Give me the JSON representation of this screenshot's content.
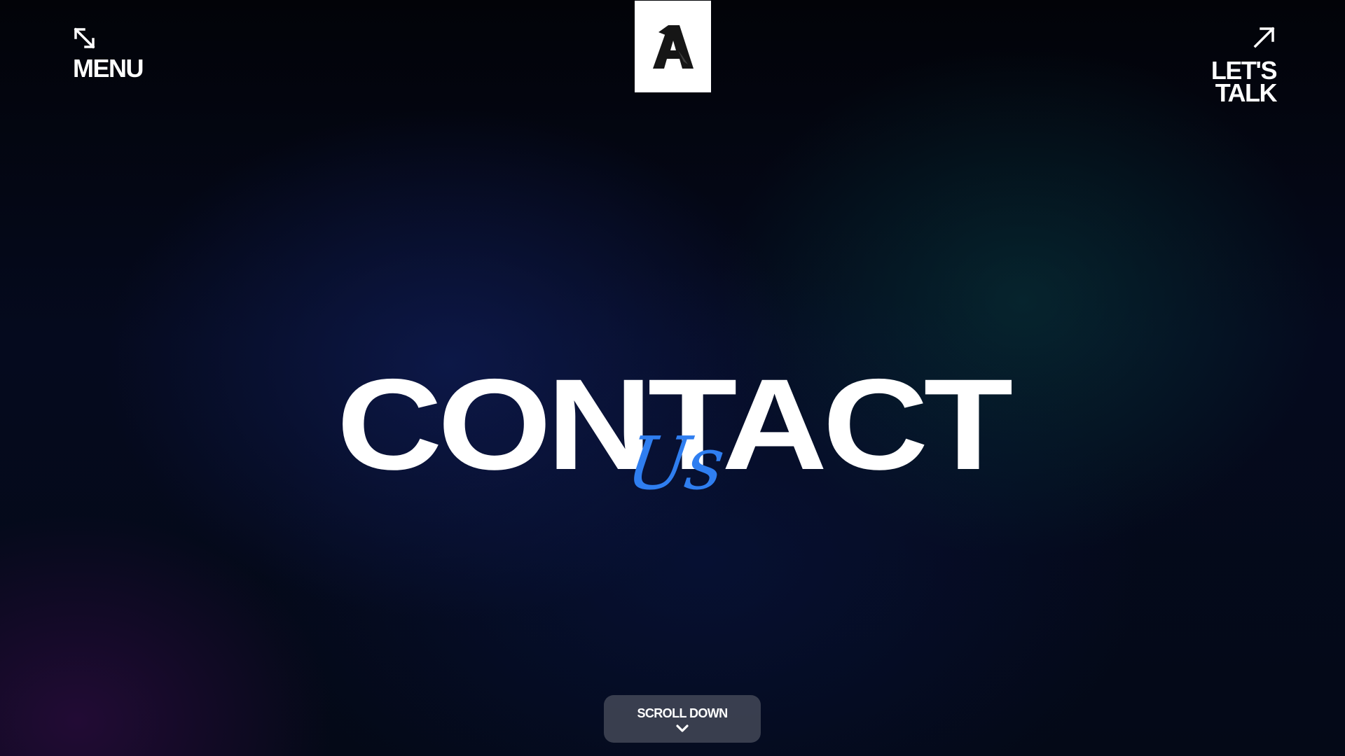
{
  "header": {
    "menu": {
      "label": "MENU",
      "icon": "expand-arrows-icon"
    },
    "logo": {
      "mark": "A",
      "icon": "brand-logo"
    },
    "cta": {
      "line1": "LET'S",
      "line2": "TALK",
      "icon": "arrow-up-right-icon"
    }
  },
  "hero": {
    "title": "CONTACT",
    "script": "Us",
    "script_color": "#2f7ef0"
  },
  "scroll": {
    "label": "SCROLL DOWN",
    "icon": "chevron-down-icon"
  }
}
